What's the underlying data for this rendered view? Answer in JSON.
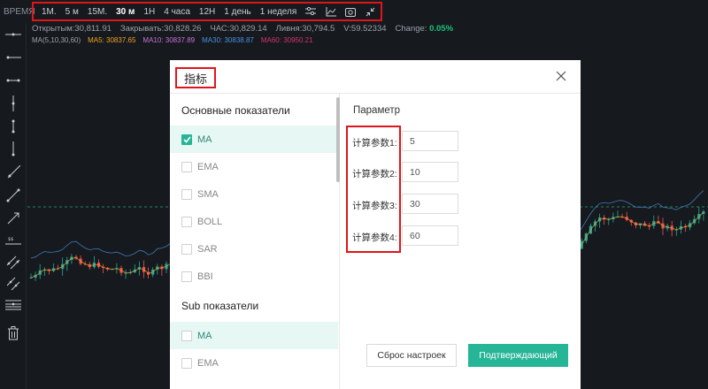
{
  "toolbar": {
    "time_label": "ВРЕМЯ",
    "timeframes": [
      "1М.",
      "5 м",
      "15М.",
      "30 м",
      "1H",
      "4 часа",
      "12H",
      "1 день",
      "1 неделя"
    ],
    "active_timeframe": "30 м",
    "icons": [
      "indicator-settings-icon",
      "line-chart-icon",
      "screenshot-icon",
      "collapse-icon"
    ]
  },
  "ohlc": {
    "open": "Открытым:30,811.91",
    "close": "Закрывать:30,828.26",
    "high": "ЧАС:30,829.14",
    "low": "Ливня:30,794.5",
    "volume": "V:59.52334",
    "change_label": "Change:",
    "change_value": "0.05%"
  },
  "ma_line": {
    "label": "MA(5,10,30,60)",
    "items": [
      {
        "text": "MA5: 30837.65",
        "color": "#f0a020"
      },
      {
        "text": "MA10: 30837.89",
        "color": "#c76fd9"
      },
      {
        "text": "MA30: 30838.87",
        "color": "#4a8fe0"
      },
      {
        "text": "MA60: 30950.21",
        "color": "#d6336c"
      }
    ]
  },
  "left_tools": [
    "horizontal-line-icon",
    "horizontal-ray-icon",
    "horizontal-segment-icon",
    "vertical-line-icon",
    "vertical-segment-icon",
    "vertical-ray-icon",
    "ray-icon",
    "segment-icon",
    "arrow-line-icon",
    "price-line-icon",
    "parallel-lines-icon",
    "price-channel-icon",
    "fibonacci-icon",
    "trash-icon"
  ],
  "colors": {
    "up": "#26a69a",
    "down": "#ef5350",
    "accent": "#27b597",
    "highlight_box": "#e0151b"
  },
  "modal": {
    "title": "指标",
    "main_section": "Основные показатели",
    "main_items": [
      {
        "label": "MA",
        "checked": true
      },
      {
        "label": "EMA",
        "checked": false
      },
      {
        "label": "SMA",
        "checked": false
      },
      {
        "label": "BOLL",
        "checked": false
      },
      {
        "label": "SAR",
        "checked": false
      },
      {
        "label": "BBI",
        "checked": false
      }
    ],
    "sub_section": "Sub показатели",
    "sub_items": [
      {
        "label": "MA",
        "checked": false
      },
      {
        "label": "EMA",
        "checked": false
      }
    ],
    "param_title": "Параметр",
    "params": [
      {
        "label": "计算参数1:",
        "value": "5"
      },
      {
        "label": "计算参数2:",
        "value": "10"
      },
      {
        "label": "计算参数3:",
        "value": "30"
      },
      {
        "label": "计算参数4:",
        "value": "60"
      }
    ],
    "reset_label": "Сброс настроек",
    "confirm_label": "Подтверждающий"
  }
}
